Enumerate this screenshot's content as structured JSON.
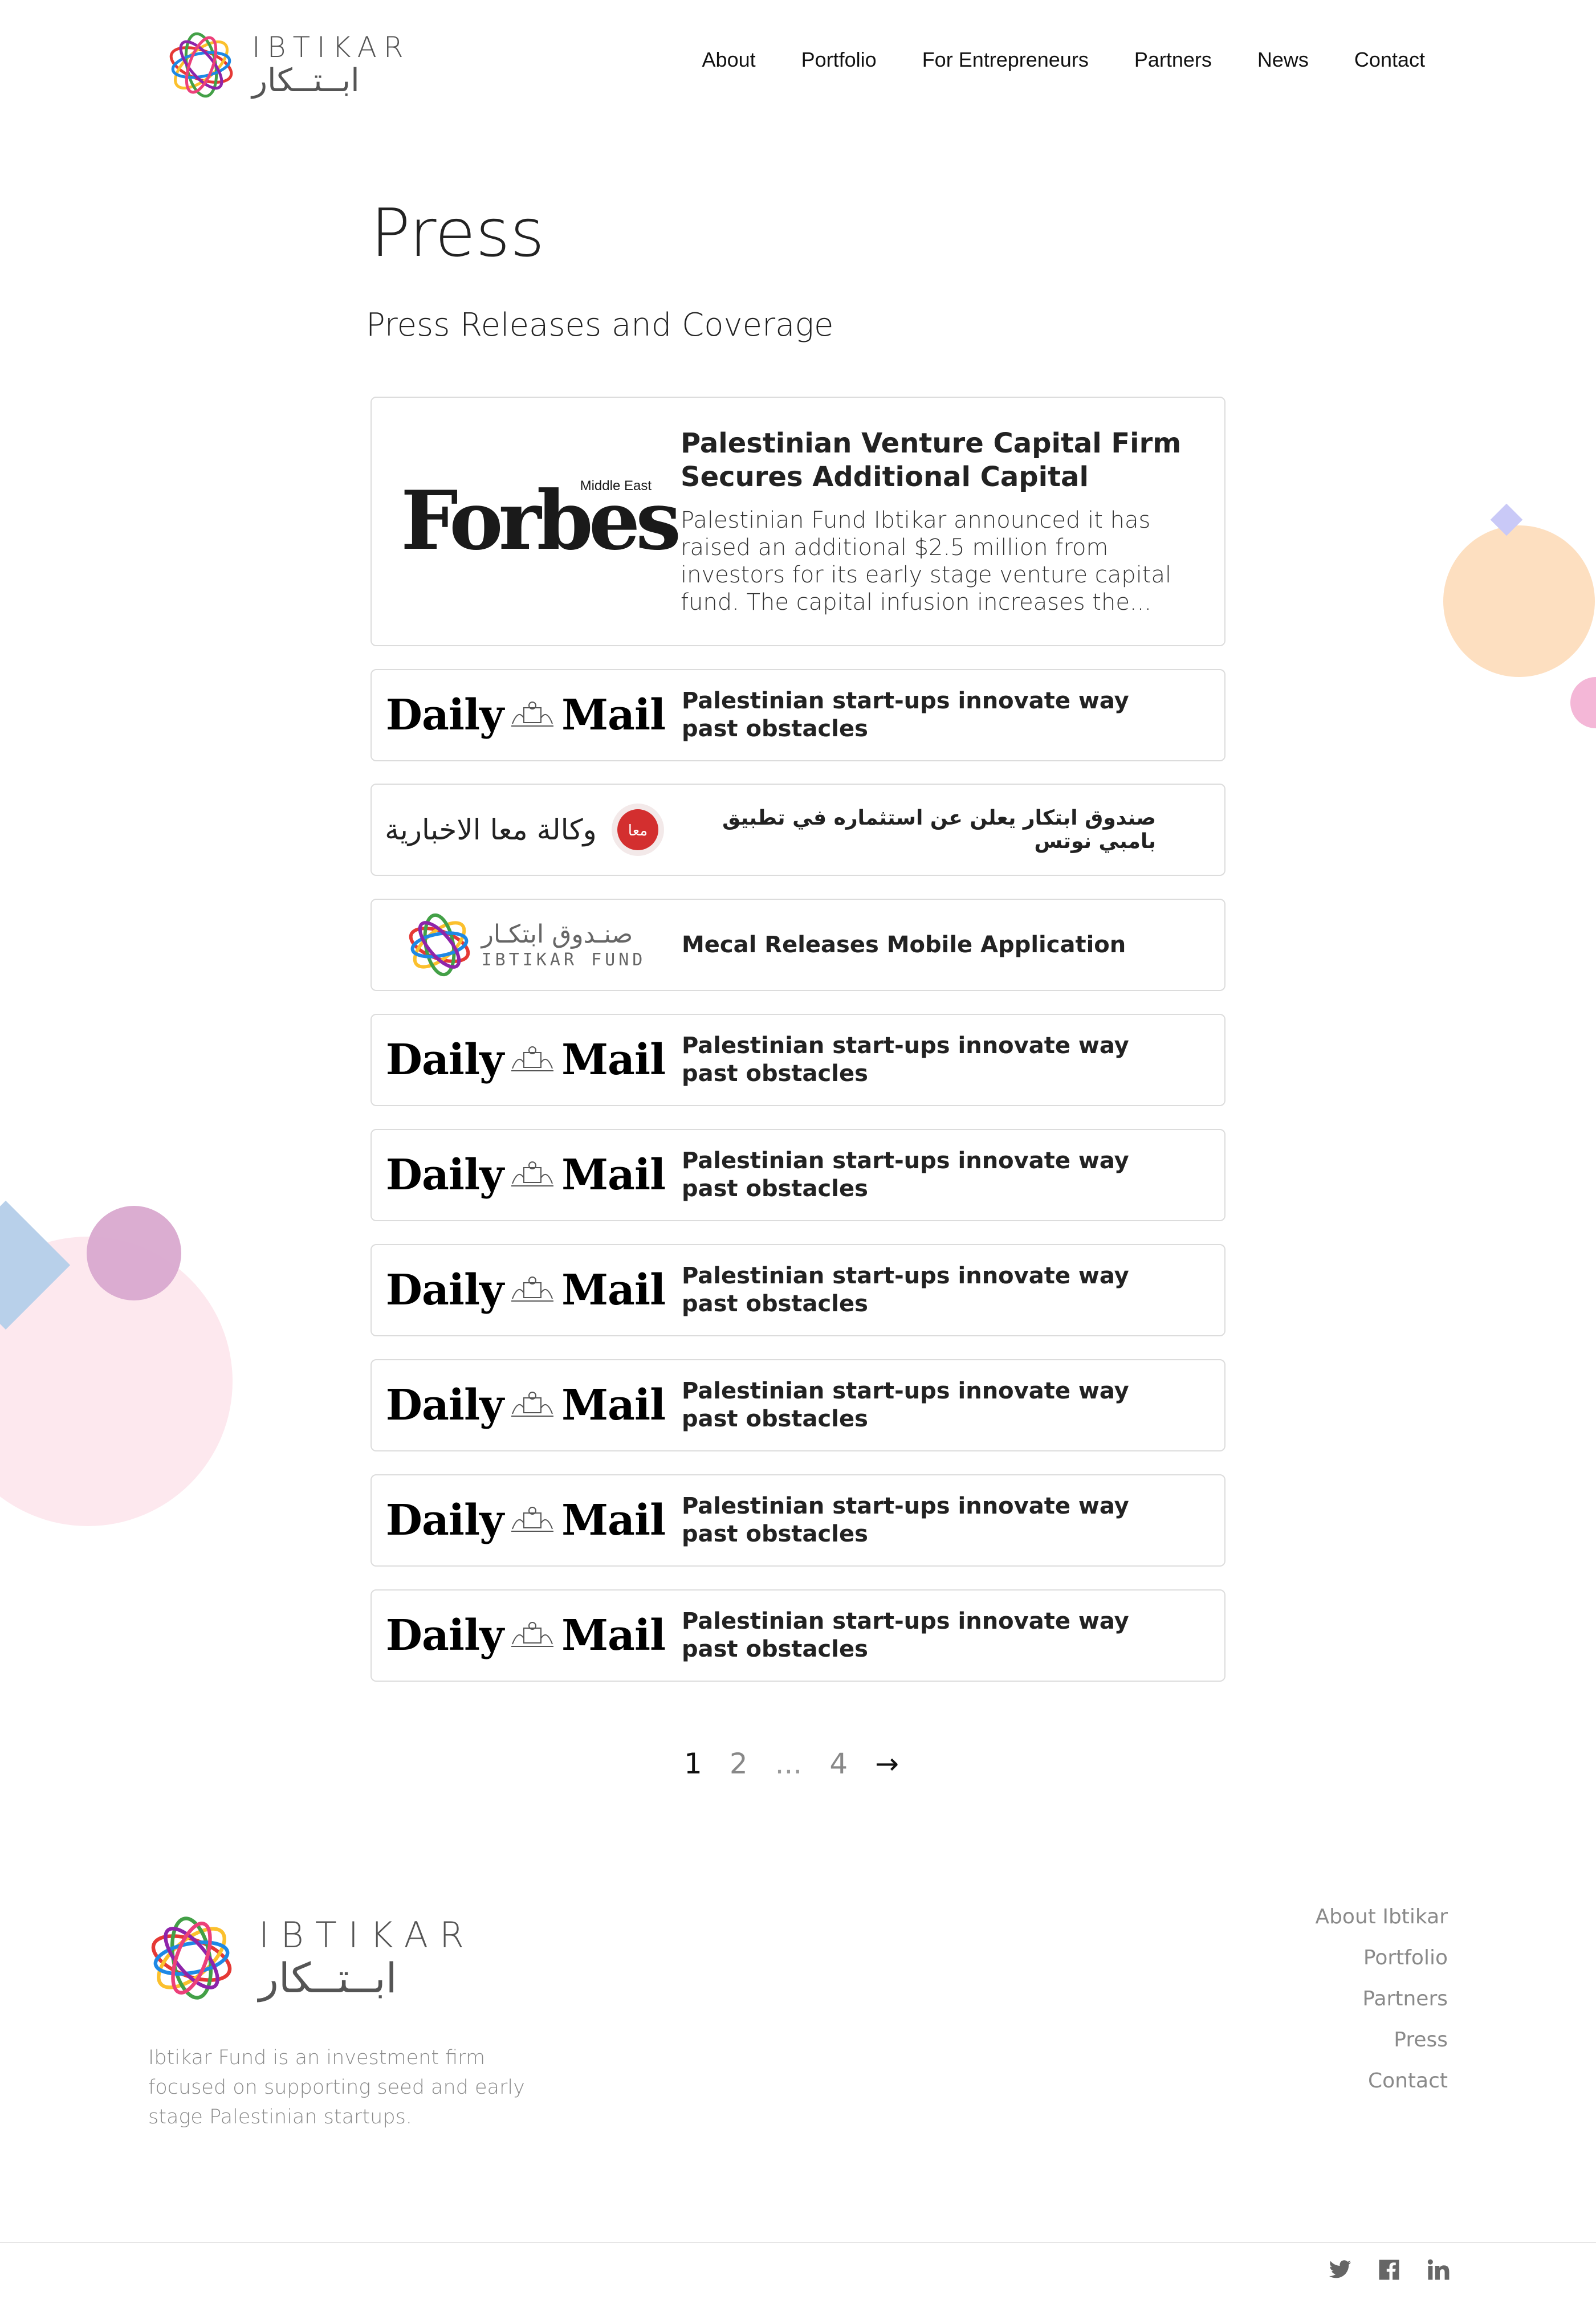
{
  "brand": {
    "name_en": "IBTIKAR",
    "name_ar": "ابــتــكار"
  },
  "nav": [
    "About",
    "Portfolio",
    "For Entrepreneurs",
    "Partners",
    "News",
    "Contact"
  ],
  "page": {
    "title": "Press",
    "subtitle": "Press Releases and Coverage"
  },
  "featured": {
    "logo": {
      "word": "Forbes",
      "sub": "Middle East"
    },
    "title": "Palestinian Venture Capital Firm Secures Additional Capital",
    "excerpt": "Palestinian Fund Ibtikar announced it has raised an additional $2.5 million from investors for its early stage venture capital fund. The capital infusion increases the..."
  },
  "logos": {
    "daily_mail": {
      "left": "Daily",
      "right": "Mail"
    },
    "maan": {
      "text": "وكالة معا الاخبارية",
      "badge": "معا"
    },
    "ibtikar_fund": {
      "ar": "صنـدوق ابتكـار",
      "en": "IBTIKAR FUND"
    }
  },
  "articles": [
    {
      "title": "Palestinian start-ups innovate way past obstacles"
    },
    {
      "title": "صندوق ابتكار يعلن عن استثماره في تطبيق بامبي نوتس"
    },
    {
      "title": "Mecal Releases Mobile Application"
    },
    {
      "title": "Palestinian start-ups innovate way past obstacles"
    },
    {
      "title": "Palestinian start-ups innovate way past obstacles"
    },
    {
      "title": "Palestinian start-ups innovate way past obstacles"
    },
    {
      "title": "Palestinian start-ups innovate way past obstacles"
    },
    {
      "title": "Palestinian start-ups innovate way past obstacles"
    },
    {
      "title": "Palestinian start-ups innovate way past obstacles"
    }
  ],
  "pagination": {
    "current": "1",
    "pages": [
      "2",
      "4"
    ],
    "ellipsis": "...",
    "next": "→"
  },
  "footer": {
    "description": "Ibtikar Fund is an investment firm focused on supporting seed and early stage Palestinian startups.",
    "links": [
      "About Ibtikar",
      "Portfolio",
      "Partners",
      "Press",
      "Contact"
    ],
    "social": [
      "twitter-icon",
      "facebook-icon",
      "linkedin-icon"
    ]
  },
  "colors": {
    "peach": "#fddfc0",
    "lavender": "#c9c9f7",
    "pink": "#f4b7d7",
    "light_pink": "#fde8ee",
    "purple": "#d9a9cf",
    "light_blue": "#b8d0ea"
  }
}
